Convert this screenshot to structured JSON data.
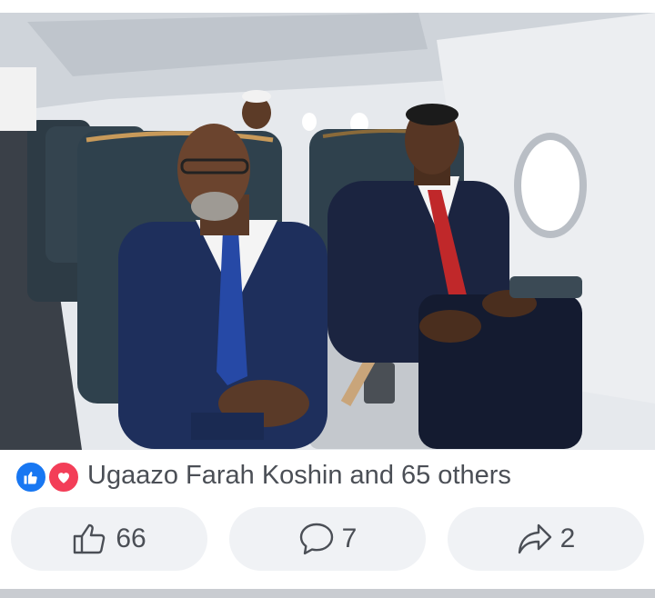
{
  "post": {
    "photo_alt": "Two men seated in airplane business class seats",
    "reactions": {
      "icons": [
        "like-icon",
        "love-icon"
      ],
      "summary": "Ugaazo Farah Koshin and 65 others"
    },
    "actions": {
      "like": {
        "icon": "thumbs-up-icon",
        "count": "66"
      },
      "comment": {
        "icon": "comment-icon",
        "count": "7"
      },
      "share": {
        "icon": "share-icon",
        "count": "2"
      }
    }
  },
  "colors": {
    "like_blue": "#1877f2",
    "love_red": "#f33e58",
    "button_bg": "#f0f2f5",
    "text_gray": "#4b4f56"
  }
}
